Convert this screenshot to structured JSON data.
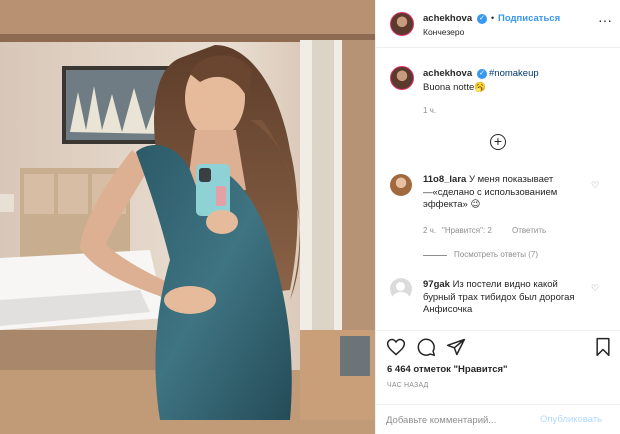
{
  "post": {
    "author": "achekhova",
    "follow_label": "Подписаться",
    "separator": "•",
    "location": "Кончезеро"
  },
  "caption": {
    "author": "achekhova",
    "hashtag": "#nomakeup",
    "text": "Buona notte🥱",
    "time": "1 ч."
  },
  "comments": [
    {
      "user": "11o8_lara",
      "text": "У меня показывает —«сделано с использованием эффекта» 😉",
      "time": "2 ч.",
      "likes": "\"Нравится\": 2",
      "reply": "Ответить",
      "view_replies": "Посмотреть ответы (7)"
    },
    {
      "user": "97gak",
      "text": "Из постели видно какой бурный трах тибидох был дорогая Анфисочка"
    }
  ],
  "stats": {
    "likes": "6 464 отметок \"Нравится\"",
    "time": "ЧАС НАЗАД"
  },
  "add_comment": {
    "placeholder": "Добавьте комментарий...",
    "publish": "Опубликовать"
  },
  "icons": {
    "verified": "verified-badge-icon",
    "more": "more-options-icon",
    "load_more": "plus-circle-icon",
    "heart": "heart-icon",
    "comment": "comment-icon",
    "share": "share-icon",
    "save": "bookmark-icon"
  },
  "colors": {
    "link": "#3897f0",
    "hashtag": "#00376b",
    "muted": "#8e8e8e",
    "publish_disabled": "#b3dbff"
  }
}
